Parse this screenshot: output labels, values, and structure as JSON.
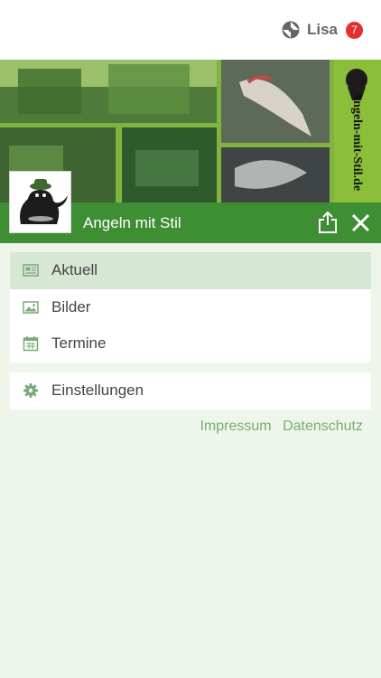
{
  "header": {
    "user_name": "Lisa",
    "notification_count": "7",
    "logo_icon": "app-logo-icon"
  },
  "group": {
    "title": "Angeln mit Stil",
    "banner_text": "Angeln-mit-Stil.de",
    "share_icon": "share-icon",
    "close_icon": "close-icon"
  },
  "menu": {
    "primary": [
      {
        "label": "Aktuell",
        "icon": "newspaper-icon",
        "active": true
      },
      {
        "label": "Bilder",
        "icon": "image-icon",
        "active": false
      },
      {
        "label": "Termine",
        "icon": "calendar-icon",
        "active": false
      }
    ],
    "secondary": [
      {
        "label": "Einstellungen",
        "icon": "gear-icon",
        "active": false
      }
    ]
  },
  "footer_links": {
    "impressum": "Impressum",
    "datenschutz": "Datenschutz"
  },
  "colors": {
    "accent": "#3e8e33",
    "active_bg": "#d6e8d3",
    "page_bg": "#eef6ec",
    "badge": "#e32f2f",
    "link": "#78ad6f"
  }
}
